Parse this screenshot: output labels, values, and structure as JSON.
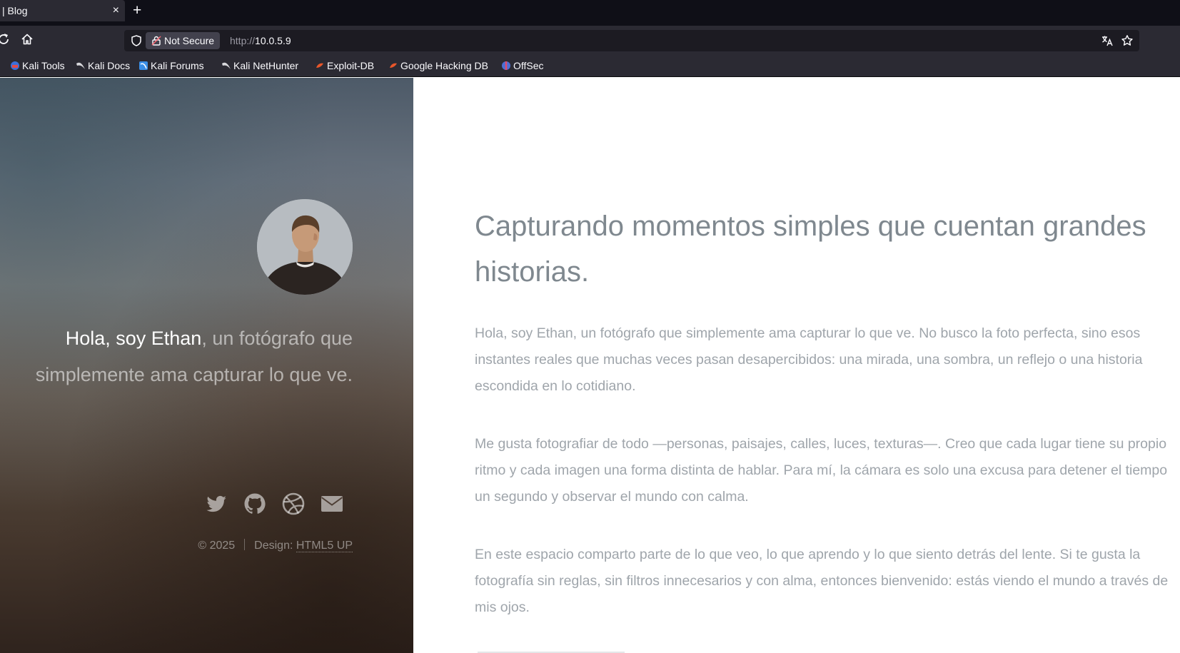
{
  "browser": {
    "tab_title": "| Blog",
    "tab_close": "×",
    "new_tab": "+",
    "not_secure": "Not Secure",
    "url_scheme": "http://",
    "url_host": "10.0.5.9",
    "bookmarks": [
      {
        "label": "Kali Tools",
        "icon": "kali-tools-icon"
      },
      {
        "label": "Kali Docs",
        "icon": "kali-docs-icon"
      },
      {
        "label": "Kali Forums",
        "icon": "kali-forums-icon"
      },
      {
        "label": "Kali NetHunter",
        "icon": "kali-nethunter-icon"
      },
      {
        "label": "Exploit-DB",
        "icon": "exploit-db-icon"
      },
      {
        "label": "Google Hacking DB",
        "icon": "ghdb-icon"
      },
      {
        "label": "OffSec",
        "icon": "offsec-icon"
      }
    ]
  },
  "hero": {
    "intro_strong": "Hola, soy Ethan",
    "intro_rest": ", un fotógrafo que simplemente ama capturar lo que ve.",
    "socials": [
      "twitter-icon",
      "github-icon",
      "dribbble-icon",
      "envelope-icon"
    ],
    "copyright": "© 2025",
    "design_label": "Design: ",
    "design_link": "HTML5 UP"
  },
  "content": {
    "headline": "Capturando momentos simples que cuentan grandes historias.",
    "paragraphs": [
      "Hola, soy Ethan, un fotógrafo que simplemente ama capturar lo que ve. No busco la foto perfecta, sino esos instantes reales que muchas veces pasan desapercibidos: una mirada, una sombra, un reflejo o una historia escondida en lo cotidiano.",
      "Me gusta fotografiar de todo —personas, paisajes, calles, luces, texturas—. Creo que cada lugar tiene su propio ritmo y cada imagen una forma distinta de hablar. Para mí, la cámara es solo una excusa para detener el tiempo un segundo y observar el mundo con calma.",
      "En este espacio comparto parte de lo que veo, lo que aprendo y lo que siento detrás del lente. Si te gusta la fotografía sin reglas, sin filtros innecesarios y con alma, entonces bienvenido: estás viendo el mundo a través de mis ojos."
    ]
  },
  "colors": {
    "chrome_dark": "#0f0f17",
    "chrome": "#2b2a33",
    "heading": "#7f888f",
    "body_text": "#9fa5ab"
  }
}
